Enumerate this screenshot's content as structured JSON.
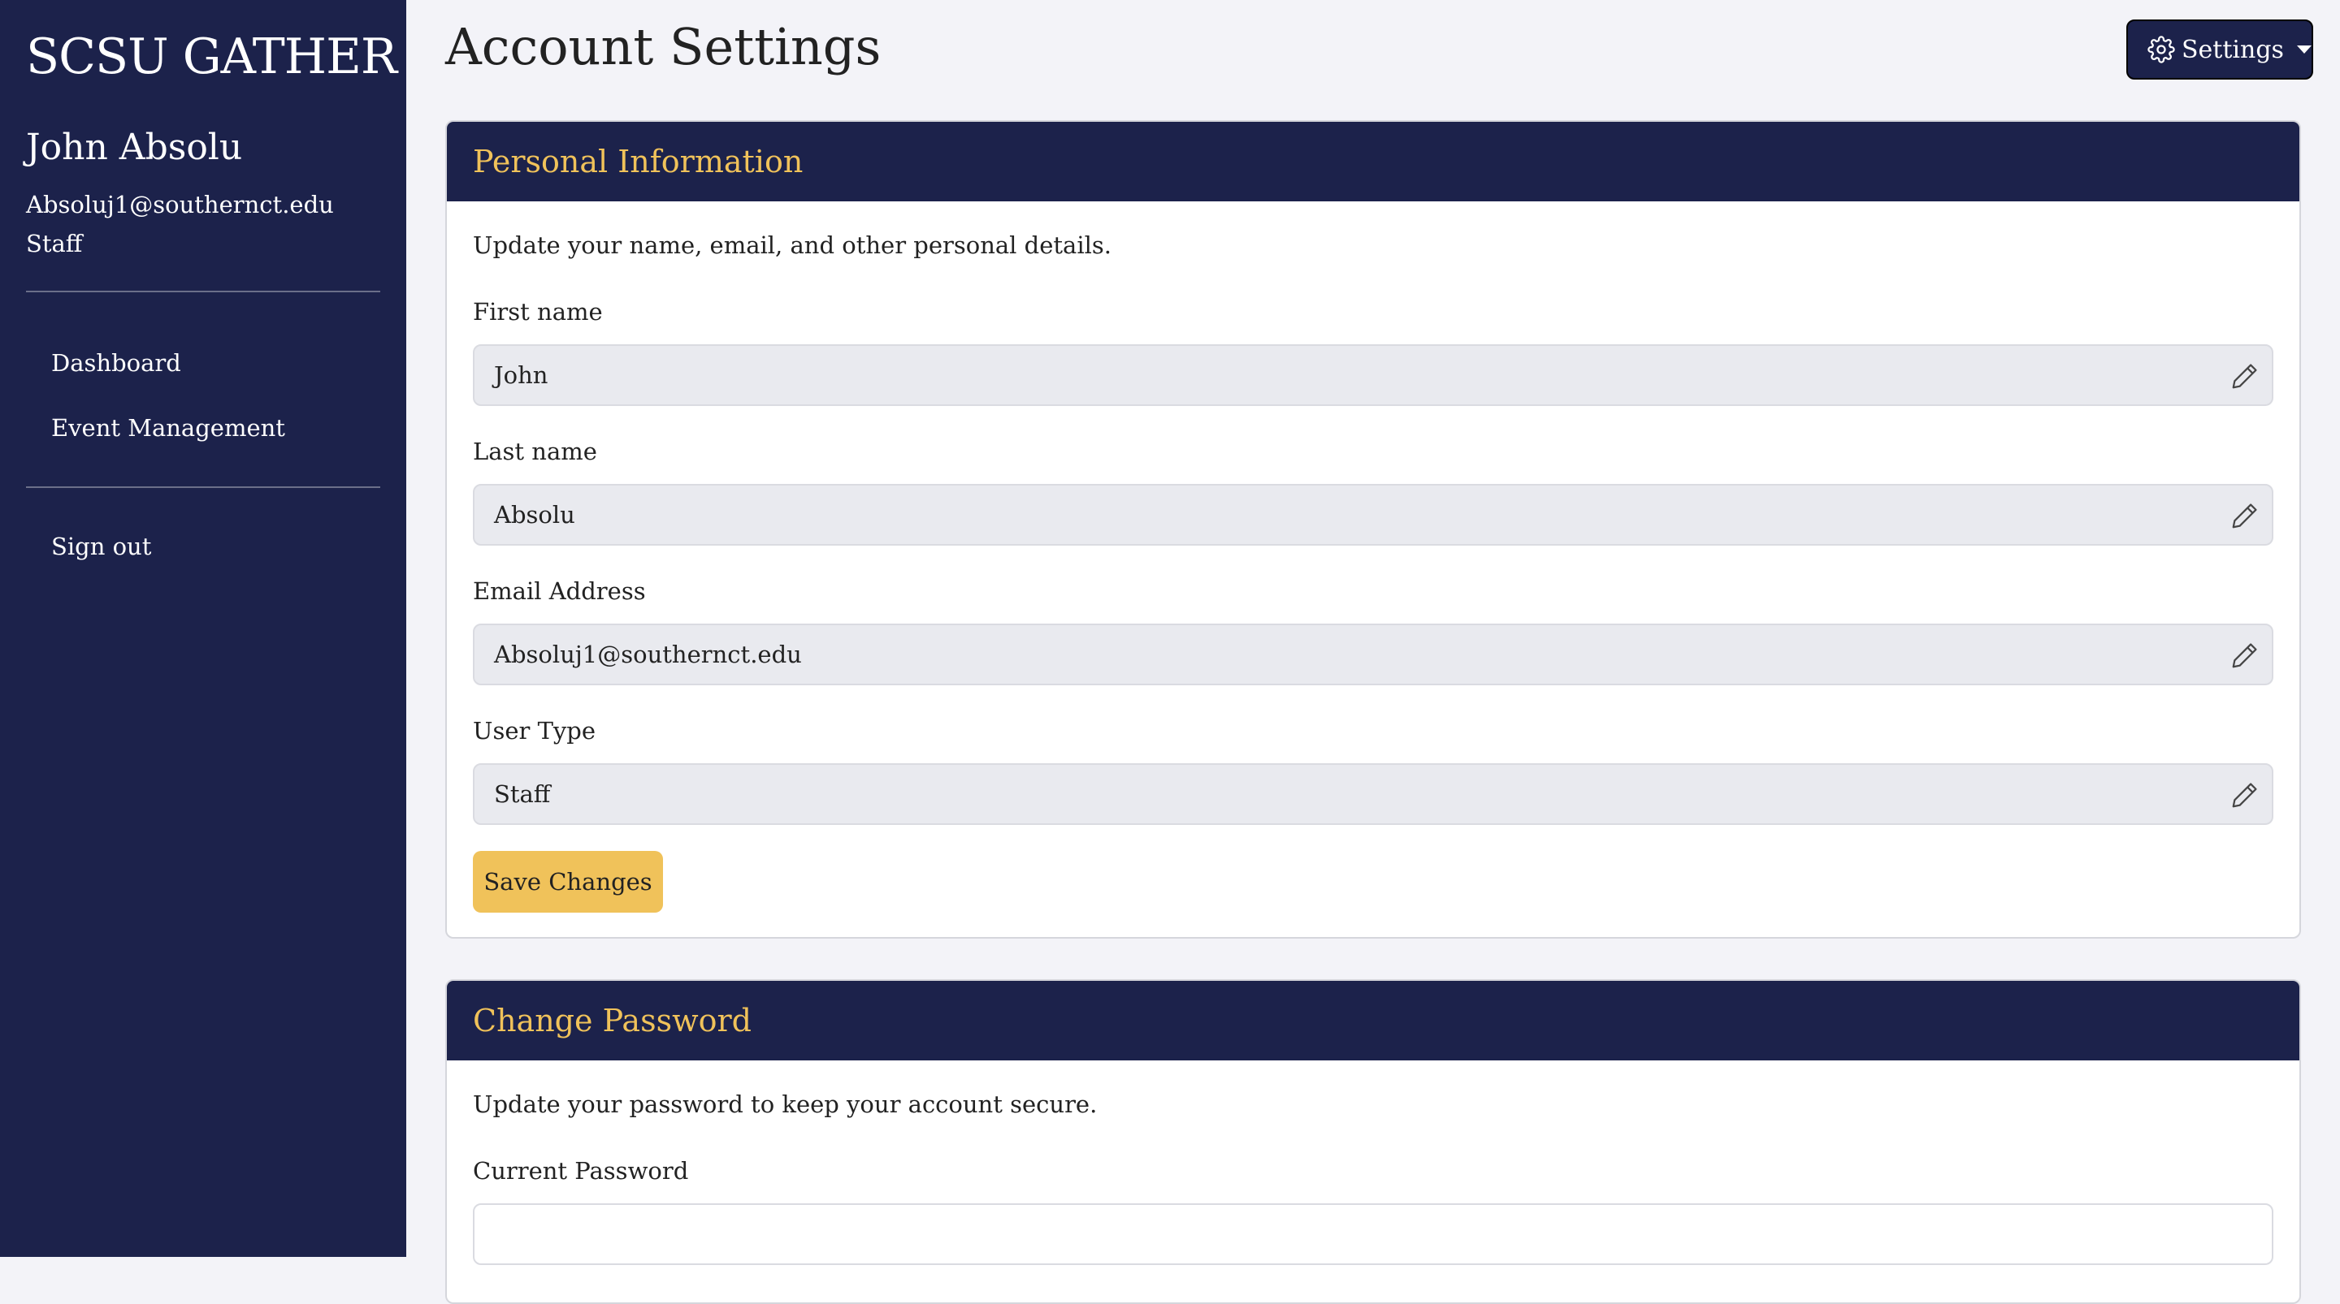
{
  "sidebar": {
    "brand": "SCSU GATHER",
    "user": {
      "name": "John Absolu",
      "email": "Absoluj1@southernct.edu",
      "type": "Staff"
    },
    "nav": [
      {
        "label": "Dashboard"
      },
      {
        "label": "Event Management"
      }
    ],
    "signout_label": "Sign out"
  },
  "header": {
    "title": "Account Settings",
    "settings_label": "Settings"
  },
  "personal": {
    "title": "Personal Information",
    "description": "Update your name, email, and other personal details.",
    "fields": [
      {
        "label": "First name",
        "value": "John"
      },
      {
        "label": "Last name",
        "value": "Absolu"
      },
      {
        "label": "Email Address",
        "value": "Absoluj1@southernct.edu"
      },
      {
        "label": "User Type",
        "value": "Staff"
      }
    ],
    "save_label": "Save Changes"
  },
  "password": {
    "title": "Change Password",
    "description": "Update your password to keep your account secure.",
    "current_label": "Current Password",
    "current_value": ""
  },
  "colors": {
    "navy": "#1c224b",
    "accent": "#f0c25a",
    "background": "#f3f3f8"
  },
  "icons": {
    "settings": "gear-icon",
    "dropdown": "caret-down-icon",
    "edit": "pencil-icon"
  }
}
